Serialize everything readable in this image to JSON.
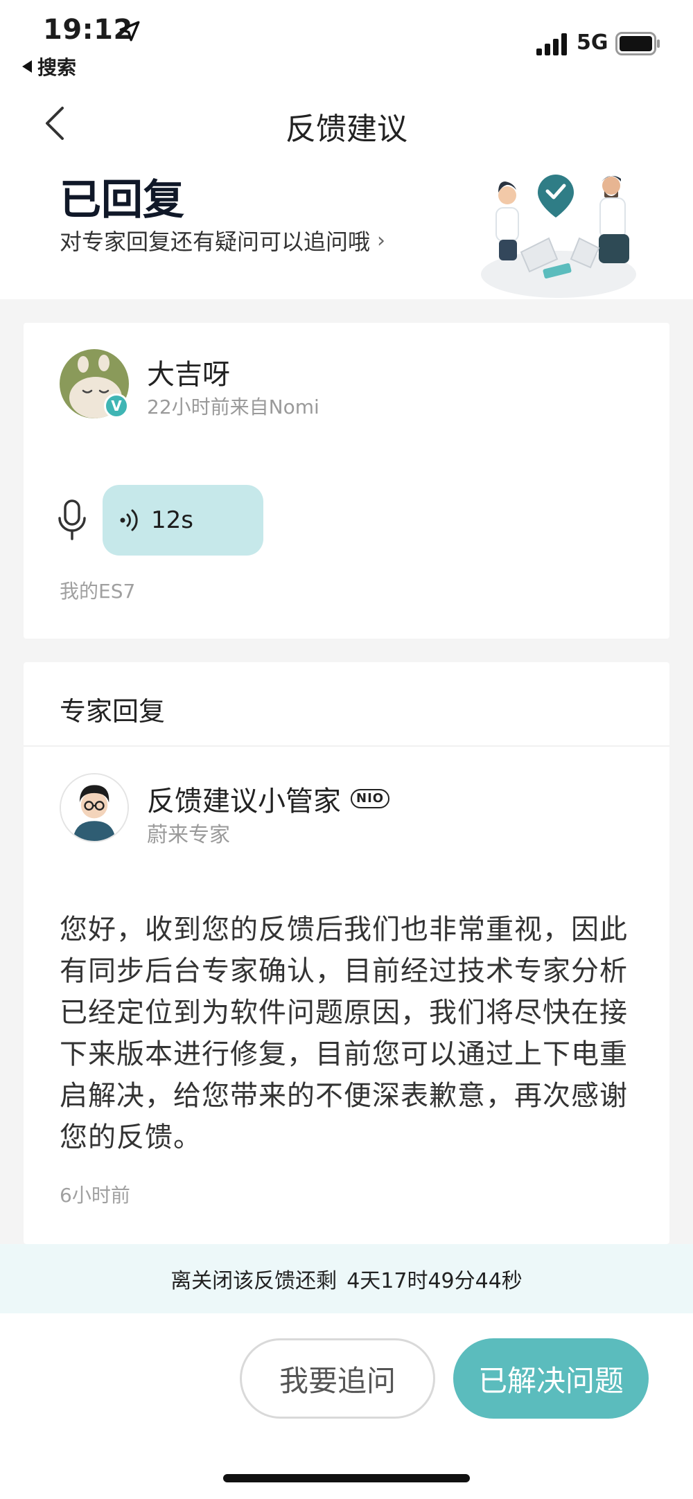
{
  "status_bar": {
    "time": "19:12",
    "back_app": "搜索",
    "network": "5G"
  },
  "nav": {
    "title": "反馈建议"
  },
  "header": {
    "status": "已回复",
    "subtitle": "对专家回复还有疑问可以追问哦",
    "chevron": "›"
  },
  "feedback": {
    "user_name": "大吉呀",
    "meta": "22小时前来自Nomi",
    "verified_badge": "V",
    "voice_duration": "12s",
    "car_tag": "我的ES7"
  },
  "expert_section": {
    "heading": "专家回复",
    "name": "反馈建议小管家",
    "brand_badge": "NIO",
    "role": "蔚来专家",
    "reply": "您好，收到您的反馈后我们也非常重视，因此有同步后台专家确认，目前经过技术专家分析已经定位到为软件问题原因，我们将尽快在接下来版本进行修复，目前您可以通过上下电重启解决，给您带来的不便深表歉意，再次感谢您的反馈。",
    "time": "6小时前"
  },
  "countdown": {
    "label": "离关闭该反馈还剩",
    "remaining": "4天17时49分44秒"
  },
  "actions": {
    "ask_label": "我要追问",
    "solved_label": "已解决问题"
  },
  "colors": {
    "accent": "#5bbcbd",
    "voice_bubble": "#c6e8ea",
    "countdown_bg": "#edf8f9",
    "page_bg": "#f4f4f4"
  },
  "icons": [
    "location-arrow-icon",
    "signal-icon",
    "battery-icon",
    "back-chevron-icon",
    "microphone-icon",
    "sound-wave-icon",
    "verified-icon"
  ]
}
